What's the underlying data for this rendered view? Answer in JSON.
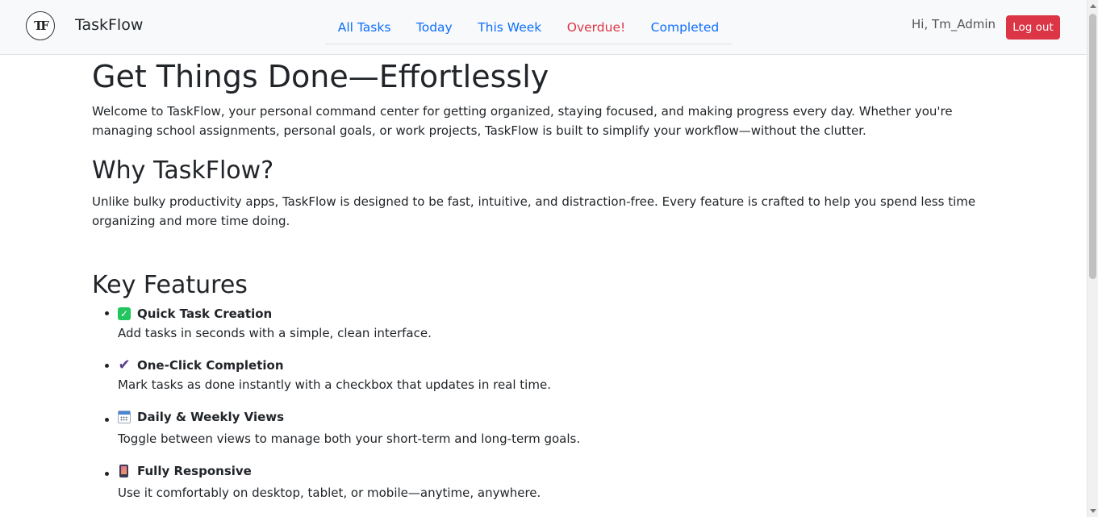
{
  "navbar": {
    "logo_text": "TF",
    "brand": "TaskFlow",
    "tabs": [
      {
        "label": "All Tasks"
      },
      {
        "label": "Today"
      },
      {
        "label": "This Week"
      },
      {
        "label": "Overdue!"
      },
      {
        "label": "Completed"
      }
    ],
    "greeting": "Hi, Tm_Admin",
    "logout_label": "Log out"
  },
  "main": {
    "title": "Get Things Done—Effortlessly",
    "intro": "Welcome to TaskFlow, your personal command center for getting organized, staying focused, and making progress every day. Whether you're managing school assignments, personal goals, or work projects, TaskFlow is built to simplify your workflow—without the clutter.",
    "why_heading": "Why TaskFlow?",
    "why_text": "Unlike bulky productivity apps, TaskFlow is designed to be fast, intuitive, and distraction-free. Every feature is crafted to help you spend less time organizing and more time doing.",
    "features_heading": "Key Features",
    "features": [
      {
        "icon": "check-mark-button-icon",
        "title": "Quick Task Creation",
        "desc": "Add tasks in seconds with a simple, clean interface."
      },
      {
        "icon": "check-mark-icon",
        "title": "One-Click Completion",
        "desc": "Mark tasks as done instantly with a checkbox that updates in real time."
      },
      {
        "icon": "calendar-icon",
        "title": "Daily & Weekly Views",
        "desc": "Toggle between views to manage both your short-term and long-term goals."
      },
      {
        "icon": "mobile-phone-icon",
        "title": "Fully Responsive",
        "desc": "Use it comfortably on desktop, tablet, or mobile—anytime, anywhere."
      }
    ]
  },
  "colors": {
    "link": "#0d6efd",
    "danger": "#dc3545",
    "navbar_bg": "#f8f9fa"
  }
}
